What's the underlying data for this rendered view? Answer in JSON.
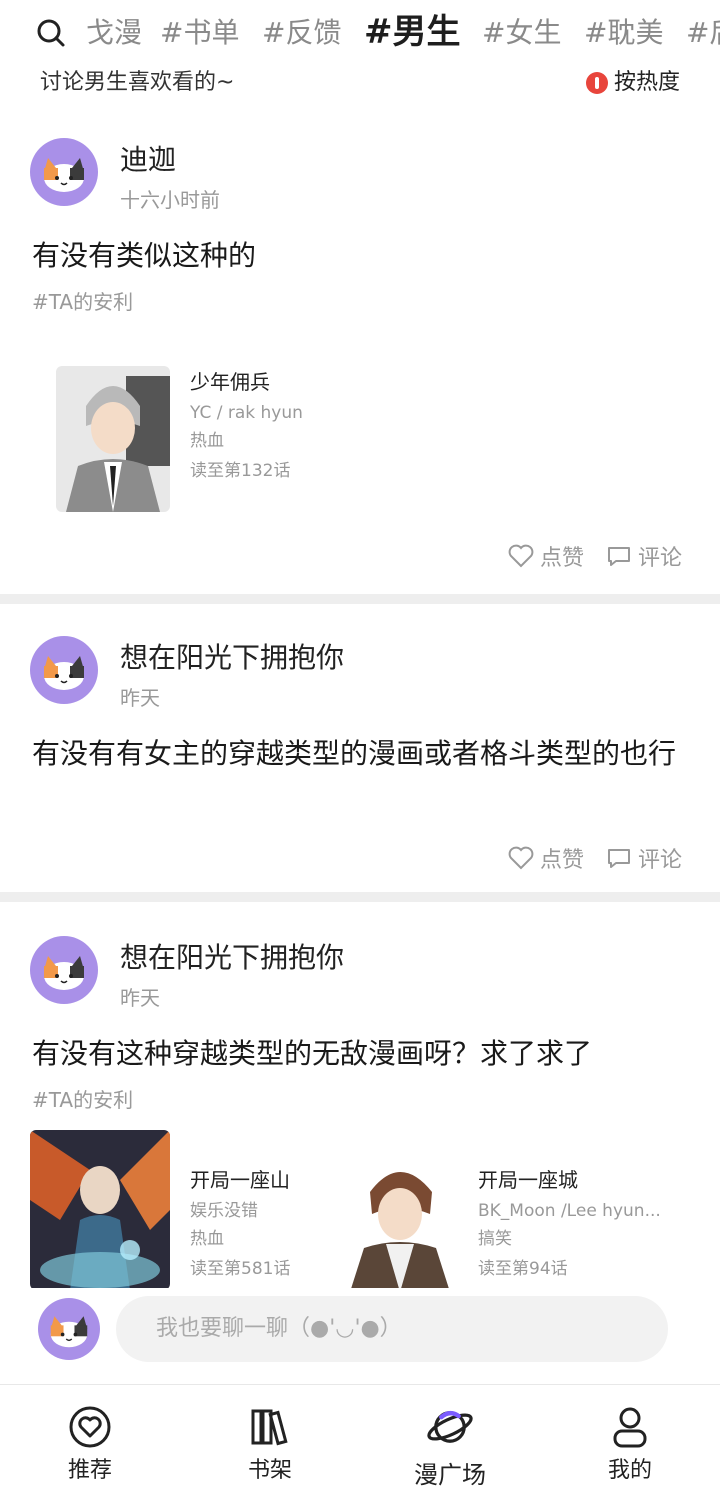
{
  "top_tags": [
    "戈漫",
    "#书单",
    "#反馈",
    "#男生",
    "#女生",
    "#耽美",
    "#后"
  ],
  "header": {
    "subtitle": "讨论男生喜欢看的~",
    "sort_label": "按热度"
  },
  "posts": [
    {
      "username": "迪迦",
      "time": "十六小时前",
      "text": "有没有类似这种的",
      "tag": "#TA的安利",
      "books": [
        {
          "title": "少年佣兵",
          "author": "YC / rak hyun",
          "genre": "热血",
          "progress": "读至第132话"
        }
      ],
      "like_label": "点赞",
      "comment_label": "评论"
    },
    {
      "username": "想在阳光下拥抱你",
      "time": "昨天",
      "text": "有没有有女主的穿越类型的漫画或者格斗类型的也行",
      "like_label": "点赞",
      "comment_label": "评论"
    },
    {
      "username": "想在阳光下拥抱你",
      "time": "昨天",
      "text": "有没有这种穿越类型的无敌漫画呀？求了求了",
      "tag": "#TA的安利",
      "books": [
        {
          "title": "开局一座山",
          "author": "娱乐没错",
          "genre": "热血",
          "progress": "读至第581话"
        },
        {
          "title": "开局一座城",
          "author": "BK_Moon /Lee hyun...",
          "genre": "搞笑",
          "progress": "读至第94话"
        }
      ]
    }
  ],
  "composer": {
    "placeholder": "我也要聊一聊（●'◡'●）"
  },
  "tabbar": [
    {
      "label": "推荐",
      "icon": "heart-circle-icon"
    },
    {
      "label": "书架",
      "icon": "books-icon"
    },
    {
      "label": "漫广场",
      "icon": "planet-icon"
    },
    {
      "label": "我的",
      "icon": "user-icon"
    }
  ],
  "colors": {
    "avatar_bg": "#a990e8",
    "sort_dot": "#e8453c",
    "accent_planet": "#7b5cff"
  }
}
